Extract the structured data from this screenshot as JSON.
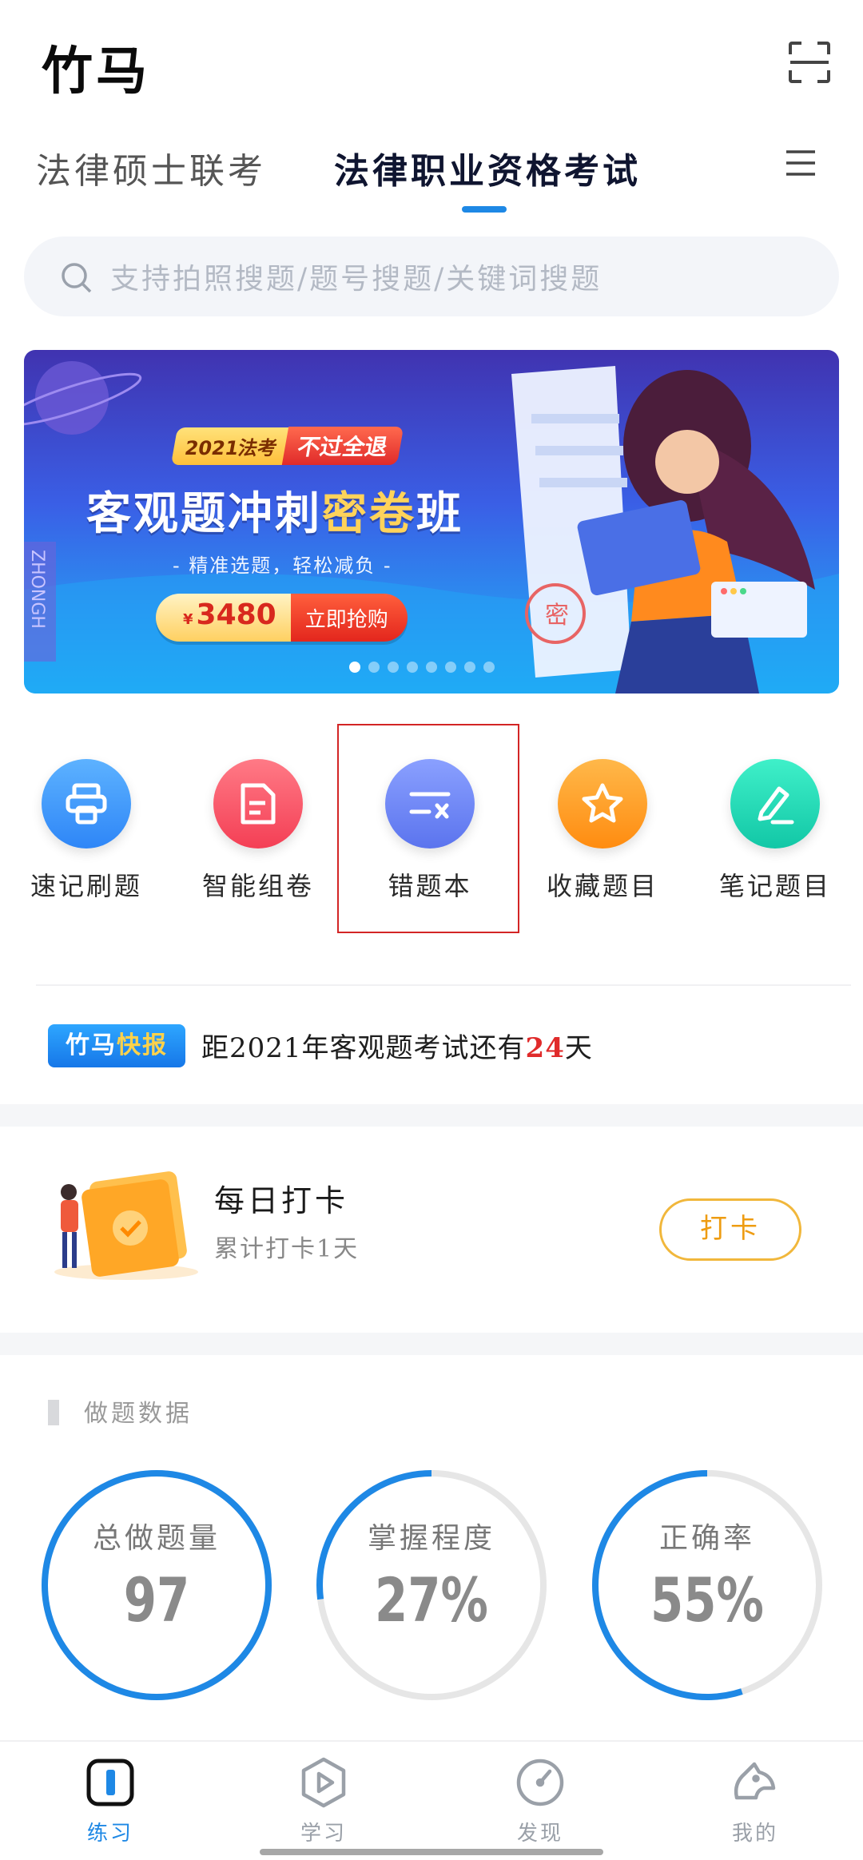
{
  "app": {
    "title": "竹马"
  },
  "tabs": [
    {
      "label": "法律硕士联考",
      "active": false
    },
    {
      "label": "法律职业资格考试",
      "active": true
    }
  ],
  "search": {
    "placeholder": "支持拍照搜题/题号搜题/关键词搜题"
  },
  "banner": {
    "badge_year": "2021法考",
    "badge_promise": "不过全退",
    "title_prefix": "客观题冲刺",
    "title_highlight": "密卷",
    "title_suffix": "班",
    "subtitle": "- 精准选题，轻松减负 -",
    "currency": "¥",
    "price": "3480",
    "cta": "立即抢购",
    "stamp": "密",
    "side_text": "ZHONGH",
    "slide_count": 8,
    "active_slide": 0
  },
  "quick_entries": [
    {
      "label": "速记刷题",
      "icon": "printer-icon",
      "color": "#3d9bff"
    },
    {
      "label": "智能组卷",
      "icon": "document-icon",
      "color": "#ff5a6b"
    },
    {
      "label": "错题本",
      "icon": "minus-x-icon",
      "color": "#6f86f6",
      "highlighted": true
    },
    {
      "label": "收藏题目",
      "icon": "star-icon",
      "color": "#ffa11c"
    },
    {
      "label": "笔记题目",
      "icon": "pen-icon",
      "color": "#1ed6b6"
    }
  ],
  "news": {
    "badge_a": "竹马",
    "badge_b": "快报",
    "text_before": "距2021年客观题考试还有",
    "days": "24",
    "text_after": "天"
  },
  "checkin": {
    "title": "每日打卡",
    "subtitle": "累计打卡1天",
    "button": "打卡"
  },
  "stats": {
    "section_title": "做题数据",
    "items": [
      {
        "label": "总做题量",
        "value": "97",
        "progress": 1.0
      },
      {
        "label": "掌握程度",
        "value": "27%",
        "progress": 0.27
      },
      {
        "label": "正确率",
        "value": "55%",
        "progress": 0.55
      }
    ]
  },
  "bottom_nav": [
    {
      "label": "练习",
      "icon": "practice-icon",
      "active": true
    },
    {
      "label": "学习",
      "icon": "play-hexagon-icon",
      "active": false
    },
    {
      "label": "发现",
      "icon": "compass-icon",
      "active": false
    },
    {
      "label": "我的",
      "icon": "horse-icon",
      "active": false
    }
  ],
  "colors": {
    "accent": "#1e88e5",
    "highlight_red": "#e02b2b",
    "checkin_orange": "#f1b73b",
    "ring_track": "#e6e6e6"
  }
}
